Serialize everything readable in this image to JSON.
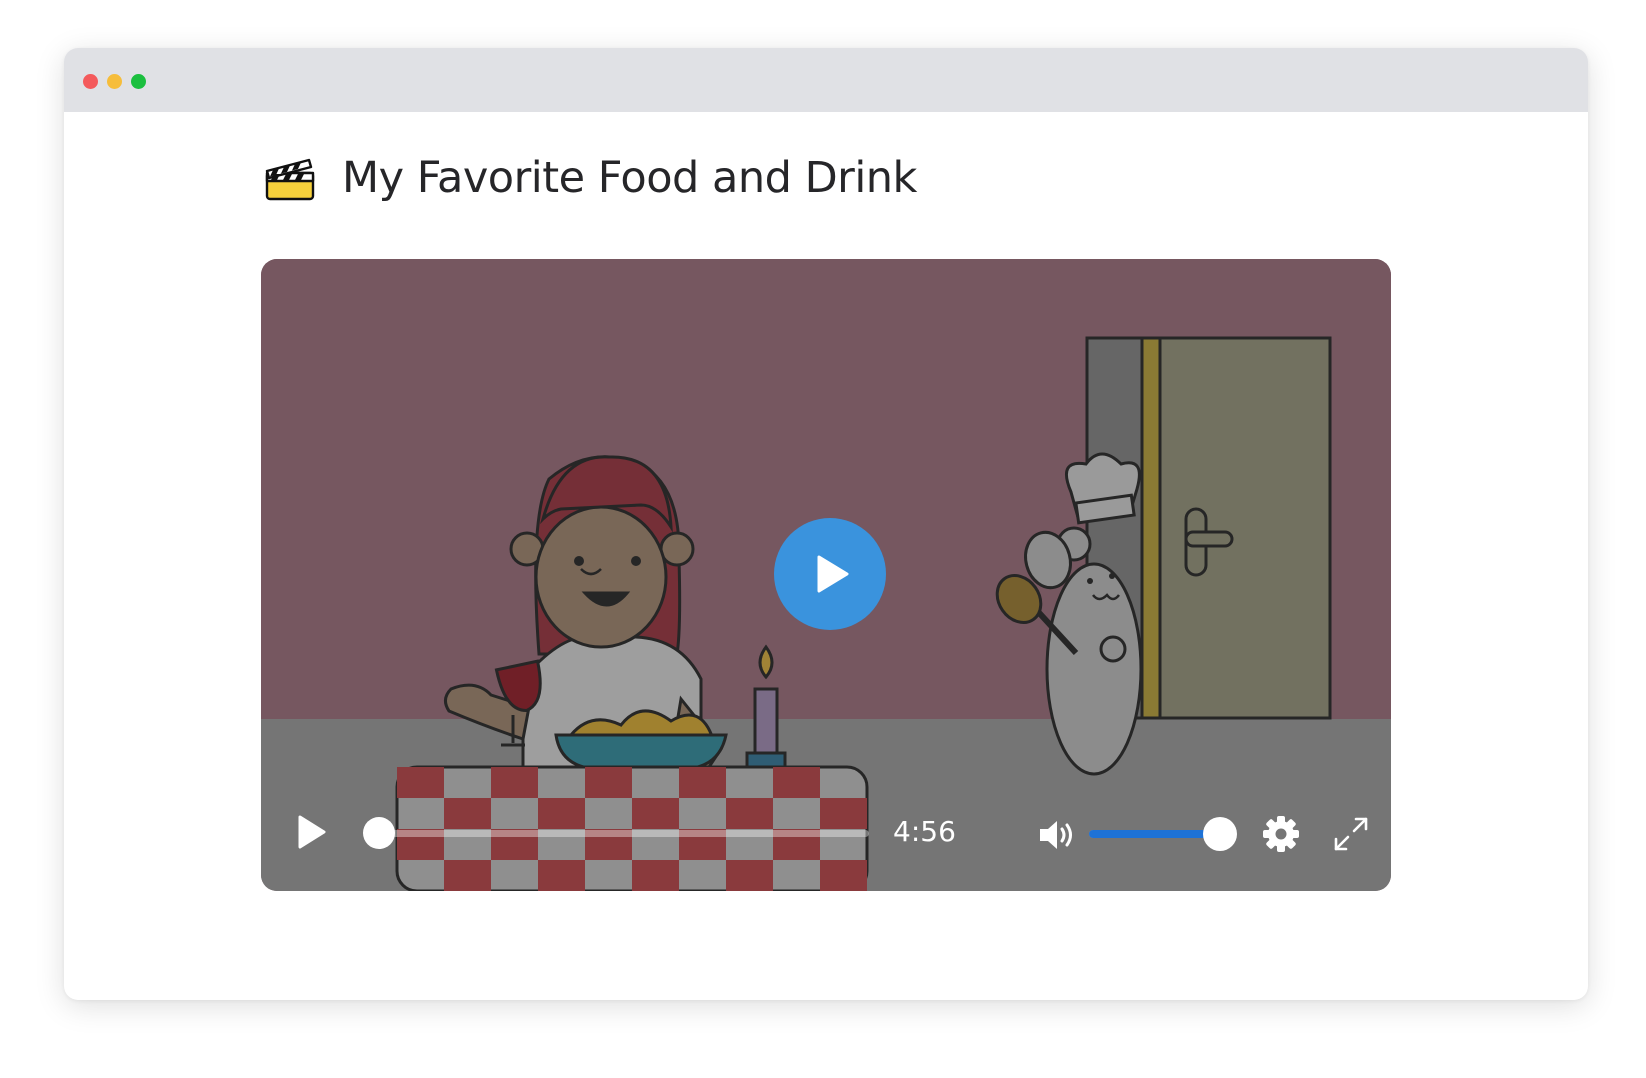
{
  "window": {
    "traffic_lights": [
      {
        "name": "close",
        "color": "#f45a5c"
      },
      {
        "name": "minimize",
        "color": "#f6bd3b"
      },
      {
        "name": "zoom",
        "color": "#1bbf3f"
      }
    ]
  },
  "page": {
    "title_icon": "clapperboard-icon",
    "title": "My Favorite Food and Drink"
  },
  "player": {
    "state": "paused",
    "big_play_icon": "play-icon",
    "duration_label": "4:56",
    "progress_fraction": 0.0,
    "volume_fraction": 0.95,
    "accent_color": "#3a93dd",
    "volume_color": "#1e72d6",
    "icons": {
      "play": "play-icon",
      "volume": "volume-icon",
      "settings": "gear-icon",
      "fullscreen": "expand-icon"
    }
  }
}
